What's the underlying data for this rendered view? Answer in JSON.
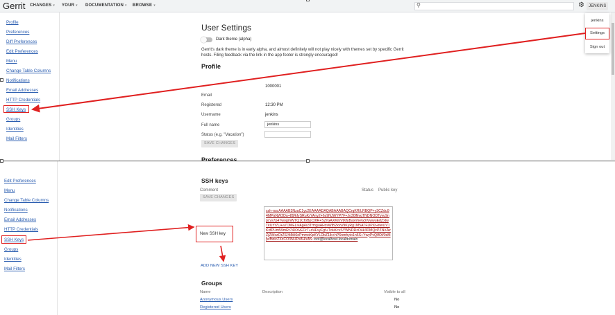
{
  "header": {
    "logo": "Gerrit",
    "nav": [
      {
        "label": "CHANGES"
      },
      {
        "label": "YOUR"
      },
      {
        "label": "DOCUMENTATION"
      },
      {
        "label": "BROWSE"
      }
    ],
    "user_badge": "JENKINS"
  },
  "account_menu": {
    "username": "jenkins",
    "settings": "Settings",
    "sign_out": "Sign out"
  },
  "sidebar_top": {
    "items": [
      "Profile",
      "Preferences",
      "Diff Preferences",
      "Edit Preferences",
      "Menu",
      "Change Table Columns",
      "Notifications",
      "Email Addresses",
      "HTTP Credentials",
      "SSH Keys",
      "Groups",
      "Identities",
      "Mail Filters"
    ]
  },
  "sidebar_bottom": {
    "items": [
      "Edit Preferences",
      "Menu",
      "Change Table Columns",
      "Notifications",
      "Email Addresses",
      "HTTP Credentials",
      "SSH Keys",
      "Groups",
      "Identities",
      "Mail Filters"
    ]
  },
  "settings": {
    "title": "User Settings",
    "dark_theme_label": "Dark theme (alpha)",
    "dark_theme_on": false,
    "info": "Gerrit's dark theme is in early alpha, and almost definitely will not play nicely with themes set by specific Gerrit hosts. Filing feedback via the link in the app footer is strongly encouraged!",
    "profile_heading": "Profile",
    "id_value": "1000001",
    "email_label": "Email",
    "registered_label": "Registered",
    "registered_value": "12:30 PM",
    "username_label": "Username",
    "username_value": "jenkins",
    "full_name_label": "Full name",
    "full_name_value": "jenkins",
    "status_label": "Status (e.g. \"Vacation\")",
    "status_value": "",
    "save_changes": "SAVE CHANGES",
    "preferences_heading": "Preferences"
  },
  "ssh": {
    "heading": "SSH keys",
    "comment_label": "Comment",
    "status_label": "Status",
    "public_key_label": "Public key",
    "save_changes": "SAVE CHANGES",
    "new_key_label": "New SSH key",
    "key_text": "ssh-rsa AAAAB3NzaC1yc2EAAAADAQABAAABAQCrqKR/LRBQP+y3CZdu94MPaNW2Du+89/kfySRuKrYAny2+6s9NJWYP7F+Jo30lNvqTNDNODTyvu9npcvs7p4TwogmWTQ1CfoBpC9tR+SZ/GAXKmVtKfyBaxnheG3rVwwuEdZxtwTkUYt7U+a7OMELivAg4s3TfmguAFbsWlB2xvv/9KyRg1M5ATFUPXt+neiUV1KxfPUm59mRr74XXvECr7+r/4FvyFgf+TduKcvSYWNDRzO4k3DMQcPZNXAzZjZWxzOrZS/4tlMi6oPmmoKpKYLDbZ1lb+hP6nmhyio1n5S+YwyPvQIfOf/0sMpsfbzicZXzCO3NUPs8H/uN9",
    "key_tail": " root@localhost.localdomain",
    "add_button": "ADD NEW SSH KEY",
    "groups_heading": "Groups",
    "groups_name_col": "Name",
    "groups_desc_col": "Description",
    "groups_visible_col": "Visible to all",
    "groups": [
      {
        "name": "Anonymous Users",
        "visible": "No"
      },
      {
        "name": "Registered Users",
        "visible": "No"
      }
    ]
  },
  "colors": {
    "annotation_red": "#e02020",
    "link": "#2a5db0",
    "header_bg": "#f1f3f4"
  },
  "icons": [
    "search-icon",
    "gear-icon"
  ]
}
